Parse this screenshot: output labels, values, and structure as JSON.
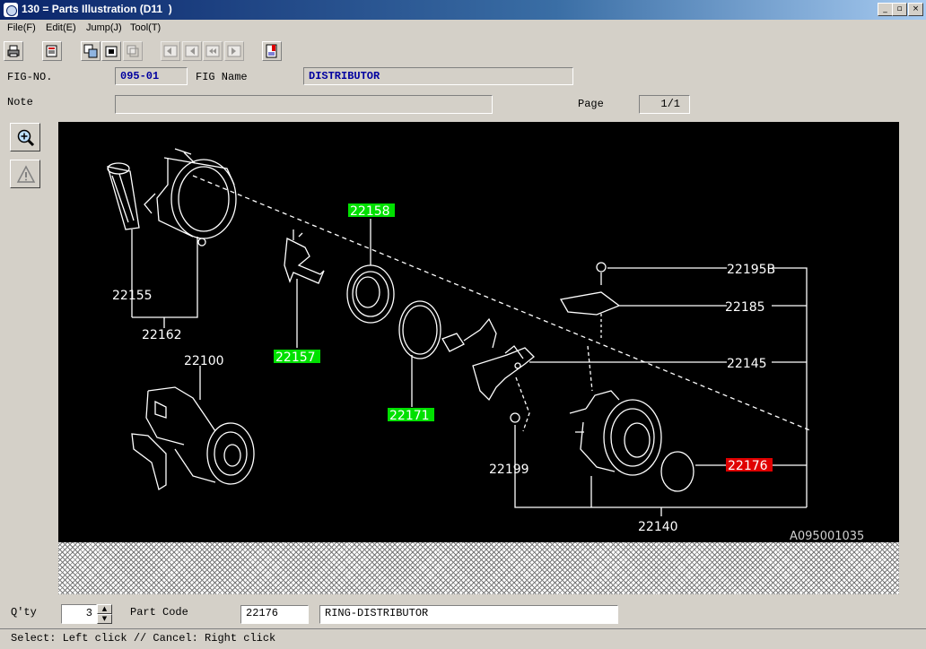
{
  "window": {
    "title": "130 = Parts Illustration (D11  )",
    "controls": [
      "_",
      "▫",
      "×"
    ]
  },
  "menu": [
    "File(F)",
    "Edit(E)",
    "Jump(J)",
    "Tool(T)"
  ],
  "toolbar": [
    "print-icon",
    "book-icon",
    "copy-illustration-icon",
    "paste-illustration-icon",
    "layer-icon",
    "fig-first-icon",
    "fig-prev-icon",
    "fig-back-icon",
    "fig-next-icon",
    "bookmark-icon"
  ],
  "header": {
    "fig_no_label": "FIG-NO.",
    "fig_no": "095-01",
    "fig_name_label": "FIG Name",
    "fig_name": "DISTRIBUTOR",
    "note_label": "Note",
    "note": "",
    "page_label": "Page",
    "page": "1/1"
  },
  "side_tools": [
    "zoom-in-icon",
    "warning-icon"
  ],
  "illustration": {
    "id": "A095001035",
    "callouts": {
      "c22155": "22155",
      "c22162": "22162",
      "c22100": "22100",
      "c22158": "22158",
      "c22157": "22157",
      "c22171": "22171",
      "c22195b": "22195B",
      "c22185": "22185",
      "c22145": "22145",
      "c22176": "22176",
      "c22199": "22199",
      "c22140": "22140"
    },
    "highlight_color": "#00e000",
    "selected_color": "#e00000"
  },
  "footer": {
    "qty_label": "Q'ty",
    "qty": "3",
    "part_code_label": "Part Code",
    "part_code": "22176",
    "part_name": "RING-DISTRIBUTOR"
  },
  "status": "Select: Left click // Cancel: Right click"
}
